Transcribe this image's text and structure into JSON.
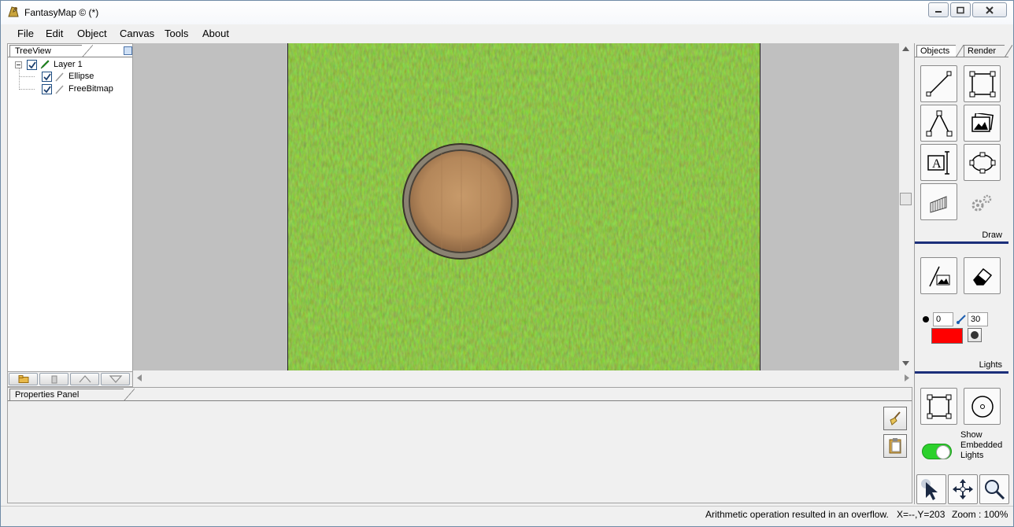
{
  "window": {
    "title": "FantasyMap © (*)"
  },
  "menu": [
    "File",
    "Edit",
    "Object",
    "Canvas",
    "Tools",
    "About"
  ],
  "tree": {
    "tab": "TreeView",
    "items": [
      {
        "label": "Layer 1",
        "checked": true
      },
      {
        "label": "Ellipse",
        "checked": true
      },
      {
        "label": "FreeBitmap",
        "checked": true
      }
    ]
  },
  "properties": {
    "tab": "Properties Panel"
  },
  "tools": {
    "tabs": [
      "Objects",
      "Render"
    ],
    "draw_label": "Draw",
    "lights_label": "Lights",
    "brush_opacity": "0",
    "brush_size": "30",
    "brush_color": "#ff0000",
    "show_embedded_lights": "Show Embedded Lights"
  },
  "status": {
    "message": "Arithmetic operation resulted in an overflow.",
    "coords": "X=--,Y=203",
    "zoom": "Zoom : 100%"
  }
}
